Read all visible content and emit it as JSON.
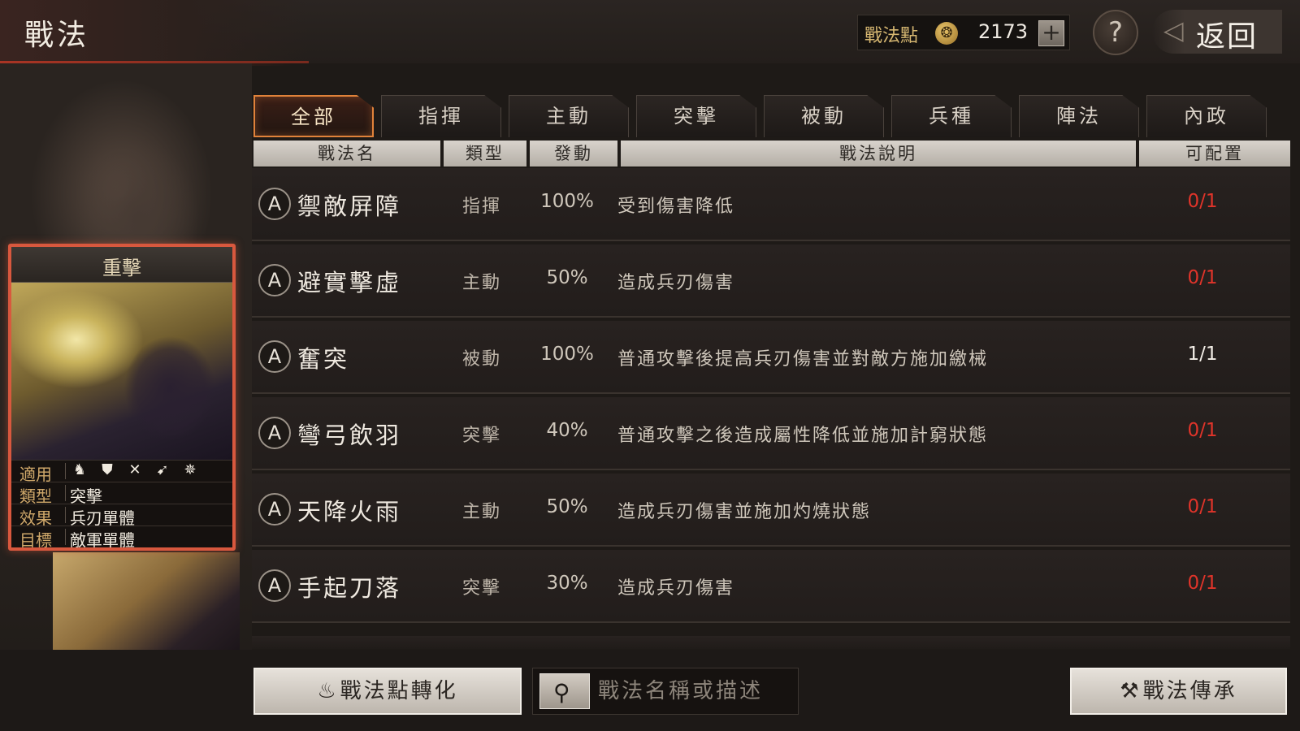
{
  "header": {
    "title": "戰法",
    "points_label": "戰法點",
    "points_value": "2173",
    "add_symbol": "+",
    "help_symbol": "?",
    "back_label": "返回"
  },
  "tabs": [
    {
      "label": "全部",
      "active": true
    },
    {
      "label": "指揮",
      "active": false
    },
    {
      "label": "主動",
      "active": false
    },
    {
      "label": "突擊",
      "active": false
    },
    {
      "label": "被動",
      "active": false
    },
    {
      "label": "兵種",
      "active": false
    },
    {
      "label": "陣法",
      "active": false
    },
    {
      "label": "內政",
      "active": false
    }
  ],
  "columns": {
    "name": "戰法名",
    "type": "類型",
    "trigger": "發動",
    "description": "戰法說明",
    "assignable": "可配置"
  },
  "rows": [
    {
      "grade": "A",
      "name": "禦敵屏障",
      "type": "指揮",
      "rate": "100%",
      "desc": "受到傷害降低",
      "slots": "0/1",
      "slots_available": false
    },
    {
      "grade": "A",
      "name": "避實擊虛",
      "type": "主動",
      "rate": "50%",
      "desc": "造成兵刃傷害",
      "slots": "0/1",
      "slots_available": false
    },
    {
      "grade": "A",
      "name": "奮突",
      "type": "被動",
      "rate": "100%",
      "desc": "普通攻擊後提高兵刃傷害並對敵方施加繳械",
      "slots": "1/1",
      "slots_available": true
    },
    {
      "grade": "A",
      "name": "彎弓飲羽",
      "type": "突擊",
      "rate": "40%",
      "desc": "普通攻擊之後造成屬性降低並施加計窮狀態",
      "slots": "0/1",
      "slots_available": false
    },
    {
      "grade": "A",
      "name": "天降火雨",
      "type": "主動",
      "rate": "50%",
      "desc": "造成兵刃傷害並施加灼燒狀態",
      "slots": "0/1",
      "slots_available": false
    },
    {
      "grade": "A",
      "name": "手起刀落",
      "type": "突擊",
      "rate": "30%",
      "desc": "造成兵刃傷害",
      "slots": "0/1",
      "slots_available": false
    }
  ],
  "card": {
    "title": "重擊",
    "applies_key": "適用",
    "troop_icons": [
      "cavalry-icon",
      "shield-icon",
      "spear-icon",
      "bow-icon",
      "siege-icon"
    ],
    "type_key": "類型",
    "type_val": "突擊",
    "effect_key": "效果",
    "effect_val": "兵刃單體",
    "target_key": "目標",
    "target_val": "敵軍單體"
  },
  "bottom": {
    "convert_label": "戰法點轉化",
    "search_placeholder": "戰法名稱或描述",
    "inherit_label": "戰法傳承"
  },
  "colors": {
    "accent_orange": "#e0823a",
    "slot_red": "#e0342a",
    "card_border": "#d8583e"
  }
}
